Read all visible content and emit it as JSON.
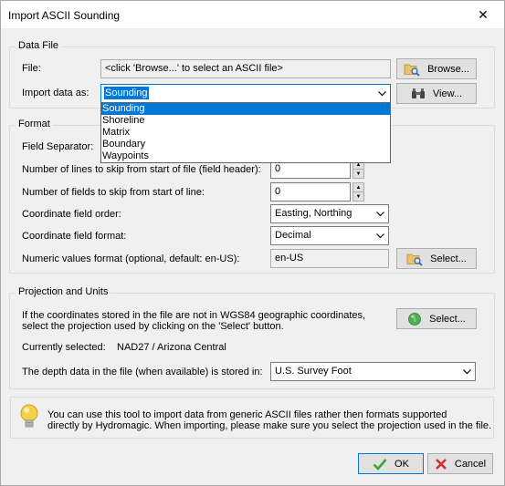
{
  "window": {
    "title": "Import ASCII Sounding",
    "close_glyph": "✕"
  },
  "data_file": {
    "group_label": "Data File",
    "file_label": "File:",
    "file_value": "<click 'Browse...' to select an ASCII file>",
    "browse_button": "Browse...",
    "import_as_label": "Import data as:",
    "import_as_value": "Sounding",
    "view_button": "View...",
    "dropdown_options": [
      "Sounding",
      "Shoreline",
      "Matrix",
      "Boundary",
      "Waypoints"
    ]
  },
  "format": {
    "group_label": "Format",
    "field_separator_label": "Field Separator:",
    "skip_lines_label": "Number of lines to skip from start of file (field header):",
    "skip_lines_value": "0",
    "skip_fields_label": "Number of fields to skip from start of line:",
    "skip_fields_value": "0",
    "coord_order_label": "Coordinate field order:",
    "coord_order_value": "Easting, Northing",
    "coord_format_label": "Coordinate field format:",
    "coord_format_value": "Decimal",
    "numeric_format_label": "Numeric values format (optional, default: en-US):",
    "numeric_format_value": "en-US",
    "numeric_select_button": "Select..."
  },
  "projection": {
    "group_label": "Projection and Units",
    "description_line1": "If the coordinates stored in the file are not in WGS84 geographic coordinates,",
    "description_line2": "select the projection used by clicking on the 'Select' button.",
    "select_button": "Select...",
    "currently_selected_label": "Currently selected:",
    "currently_selected_value": "NAD27 / Arizona Central",
    "depth_label": "The depth data in the file (when available) is stored in:",
    "depth_value": "U.S. Survey Foot"
  },
  "info": {
    "line1": "You can use this tool to import data from generic ASCII files rather then formats supported",
    "line2": "directly by Hydromagic. When importing, please make sure you select the projection used in the file."
  },
  "footer": {
    "ok_button": "OK",
    "cancel_button": "Cancel"
  },
  "icons": {
    "browse": "folder-search-icon",
    "view": "binoculars-icon",
    "numeric_select": "folder-search-icon",
    "projection_select": "globe-icon",
    "info": "lightbulb-icon",
    "ok": "checkmark-icon",
    "cancel": "cross-icon",
    "colors": {
      "accent": "#0078d7",
      "ok_green": "#3aa53a",
      "cancel_red": "#d32f2f",
      "bulb": "#f5d04a"
    }
  }
}
